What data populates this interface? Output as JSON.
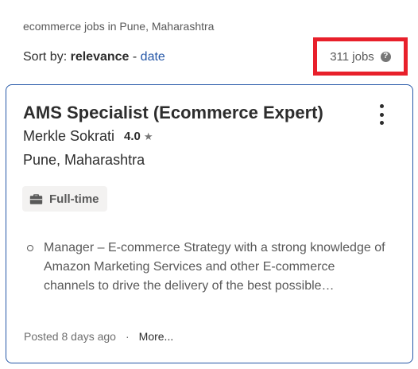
{
  "search": {
    "context": "ecommerce jobs in Pune, Maharashtra"
  },
  "sort": {
    "prefix": "Sort by:",
    "active": "relevance",
    "separator": "-",
    "alternate": "date"
  },
  "results": {
    "count": "311 jobs",
    "help_icon": "question-circle-icon",
    "highlight_color": "#e8202b"
  },
  "job": {
    "title": "AMS Specialist (Ecommerce Expert)",
    "company": "Merkle Sokrati",
    "rating": "4.0",
    "location": "Pune, Maharashtra",
    "type": "Full-time",
    "type_icon": "briefcase-icon",
    "snippet": "Manager – E-commerce Strategy with a strong knowledge of Amazon Marketing Services and other E-commerce channels to drive the delivery of the best possible…",
    "posted": "Posted 8 days ago",
    "more_link": "More..."
  },
  "colors": {
    "link": "#2557a7",
    "card_border": "#2557a7"
  }
}
